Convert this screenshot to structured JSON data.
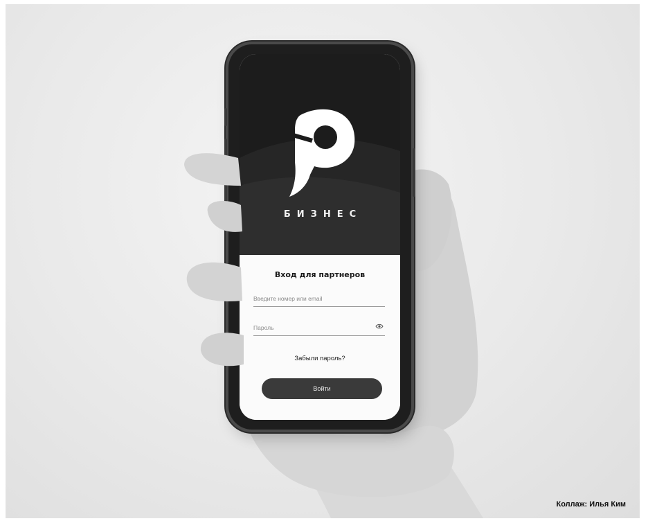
{
  "app": {
    "brand_name": "БИЗНЕС",
    "logo_icon": "p-logo-icon"
  },
  "login": {
    "title": "Вход для партнеров",
    "login_placeholder": "Введите номер или email",
    "password_placeholder": "Пароль",
    "password_toggle_icon": "eye-icon",
    "forgot_link": "Забыли пароль?",
    "submit_label": "Войти"
  },
  "caption": {
    "credit": "Коллаж: Илья Ким"
  },
  "colors": {
    "hero_background": "#1c1c1c",
    "form_background": "#fbfbfb",
    "button_background": "#3a3a3a",
    "button_text": "#e8e8e8"
  }
}
